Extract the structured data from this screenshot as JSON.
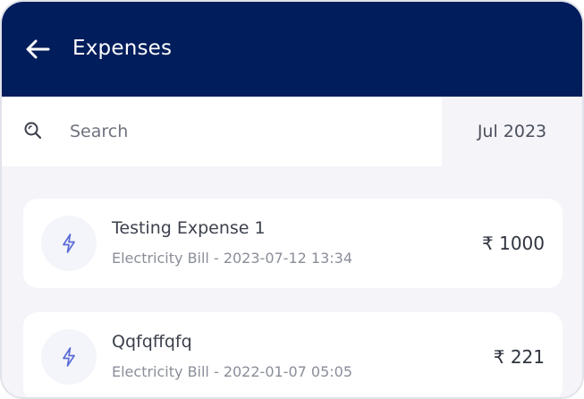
{
  "header": {
    "title": "Expenses",
    "back_icon": "arrow-left-icon",
    "background": "#011d5b"
  },
  "search": {
    "placeholder": "Search",
    "value": "",
    "icon": "search-icon"
  },
  "filter": {
    "month_label": "Jul 2023"
  },
  "expenses": [
    {
      "title": "Testing Expense 1",
      "category": "Electricity Bill",
      "datetime": "2023-07-12 13:34",
      "subtitle": "Electricity Bill - 2023-07-12 13:34",
      "amount": "₹ 1000",
      "icon": "lightning-icon"
    },
    {
      "title": "Qqfqffqfq",
      "category": "Electricity Bill",
      "datetime": "2022-01-07 05:05",
      "subtitle": "Electricity Bill - 2022-01-07 05:05",
      "amount": "₹ 221",
      "icon": "lightning-icon"
    }
  ],
  "colors": {
    "accent_icon": "#5b6bd6",
    "page_background": "#f4f4f9"
  }
}
